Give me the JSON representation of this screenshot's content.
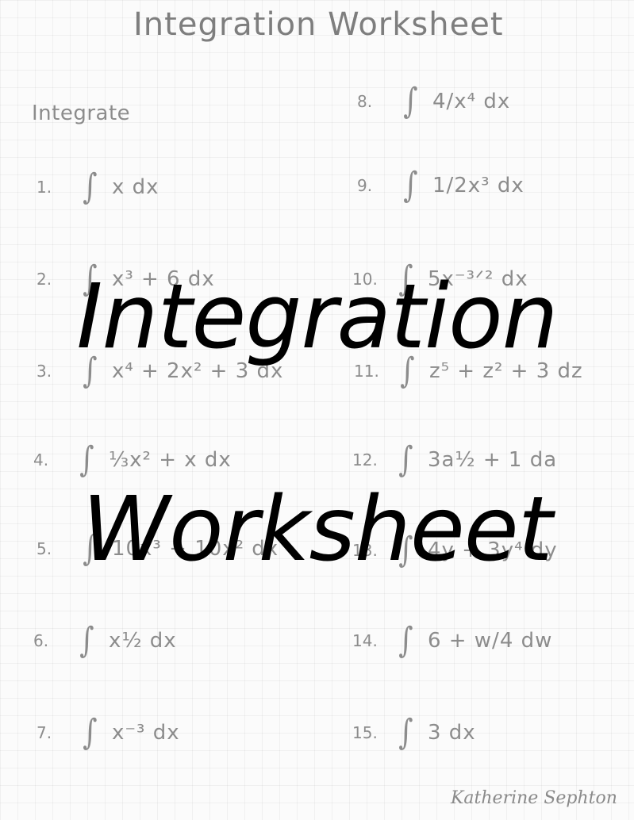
{
  "worksheet": {
    "handwritten_title": "Integration Worksheet",
    "instruction": "Integrate",
    "problems": [
      {
        "num": "1.",
        "expr": "x dx"
      },
      {
        "num": "2.",
        "expr": "x³ + 6 dx"
      },
      {
        "num": "3.",
        "expr": "x⁴ + 2x² + 3 dx"
      },
      {
        "num": "4.",
        "expr": "⅓x² + x dx"
      },
      {
        "num": "5.",
        "expr": "10x³ + 10x² dx"
      },
      {
        "num": "6.",
        "expr": "x½ dx"
      },
      {
        "num": "7.",
        "expr": "x⁻³ dx"
      },
      {
        "num": "8.",
        "expr": "4/x⁴ dx"
      },
      {
        "num": "9.",
        "expr": "1/2x³ dx"
      },
      {
        "num": "10.",
        "expr": "5x⁻³ᐟ² dx"
      },
      {
        "num": "11.",
        "expr": "z⁵ + z² + 3 dz"
      },
      {
        "num": "12.",
        "expr": "3a½ + 1 da"
      },
      {
        "num": "13.",
        "expr": "4y + 3y⁴ dy"
      },
      {
        "num": "14.",
        "expr": "6 + w/4 dw"
      },
      {
        "num": "15.",
        "expr": "3 dx"
      }
    ],
    "integral_symbol": "∫",
    "signature": "Katherine Sephton"
  },
  "overlay": {
    "line1": "Integration",
    "line2": "Worksheet"
  }
}
